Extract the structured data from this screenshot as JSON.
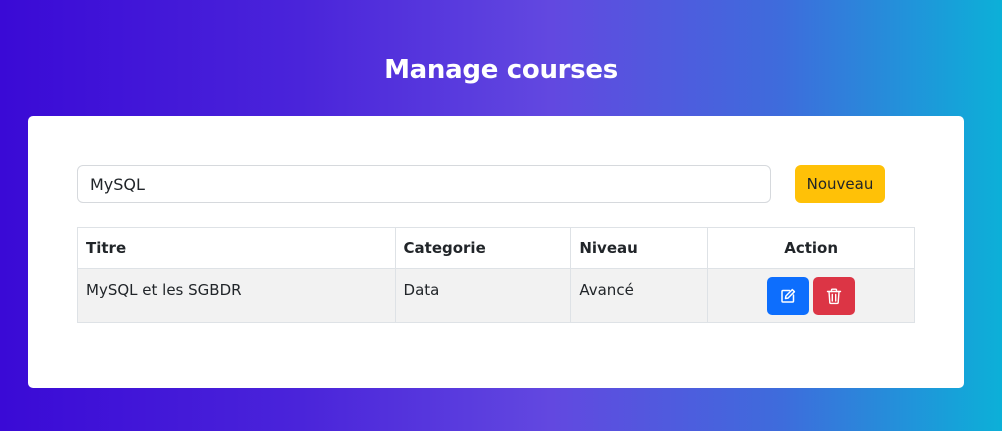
{
  "header": {
    "title": "Manage courses"
  },
  "search": {
    "value": "MySQL",
    "placeholder": ""
  },
  "toolbar": {
    "new_label": "Nouveau"
  },
  "table": {
    "columns": [
      "Titre",
      "Categorie",
      "Niveau",
      "Action"
    ],
    "rows": [
      {
        "titre": "MySQL et les SGBDR",
        "categorie": "Data",
        "niveau": "Avancé",
        "actions": [
          "edit-icon",
          "trash-icon"
        ]
      }
    ]
  },
  "colors": {
    "gradient_start": "#3a0ad6",
    "gradient_mid": "#6248e0",
    "gradient_end": "#0cb0d8",
    "new_button": "#ffc107",
    "edit_button": "#0d6efd",
    "delete_button": "#dc3545"
  }
}
